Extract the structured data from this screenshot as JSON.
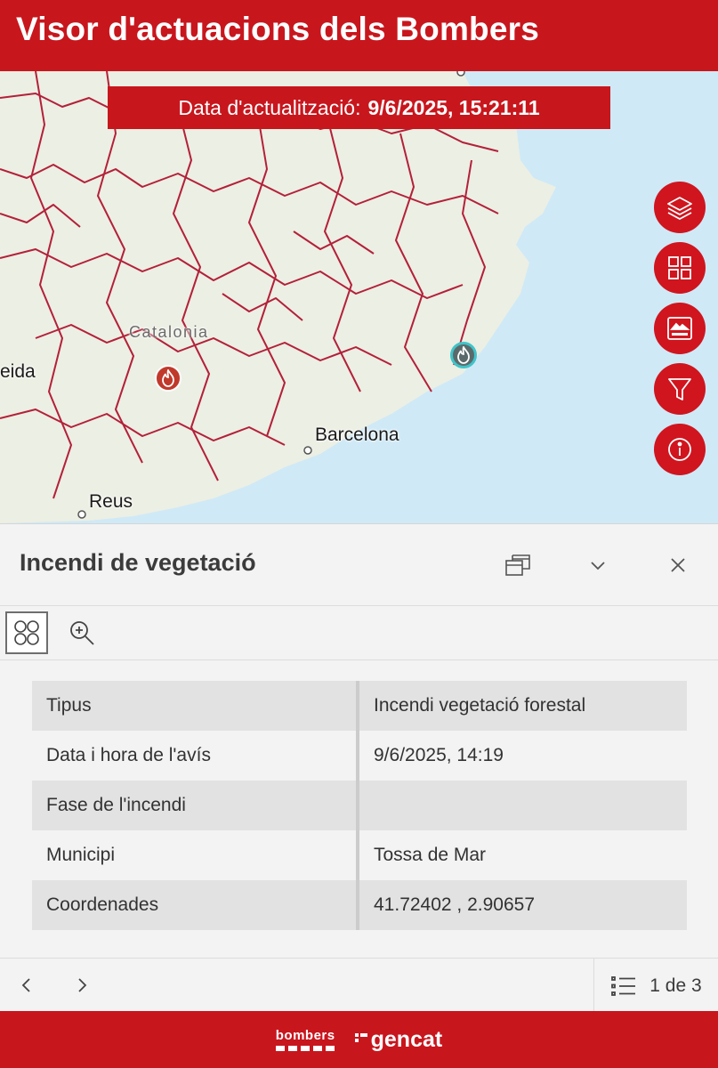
{
  "header": {
    "title": "Visor d'actuacions dels Bombers"
  },
  "update": {
    "label": "Data d'actualització:",
    "value": "9/6/2025, 15:21:11"
  },
  "map": {
    "labels": {
      "region": "Catalonia",
      "lleida": "eida",
      "barcelona": "Barcelona",
      "reus": "Reus"
    },
    "colors": {
      "sea": "#cfe9f7",
      "land": "#ecefe3",
      "border": "#b3203a",
      "marker_active": "#c0392b",
      "marker_selected": "#2e9fa4"
    }
  },
  "map_controls": [
    {
      "icon": "layers-icon"
    },
    {
      "icon": "grid-icon"
    },
    {
      "icon": "basemap-icon"
    },
    {
      "icon": "filter-icon"
    },
    {
      "icon": "info-icon"
    }
  ],
  "popup": {
    "title": "Incendi de vegetació",
    "rows": [
      {
        "key": "Tipus",
        "value": "Incendi vegetació forestal"
      },
      {
        "key": "Data i hora de l'avís",
        "value": "9/6/2025, 14:19"
      },
      {
        "key": "Fase de l'incendi",
        "value": ""
      },
      {
        "key": "Municipi",
        "value": "Tossa de Mar"
      },
      {
        "key": "Coordenades",
        "value": "41.72402 , 2.90657"
      }
    ],
    "pager": "1 de 3"
  },
  "footer": {
    "bombers": "bombers",
    "gencat": "gencat"
  }
}
